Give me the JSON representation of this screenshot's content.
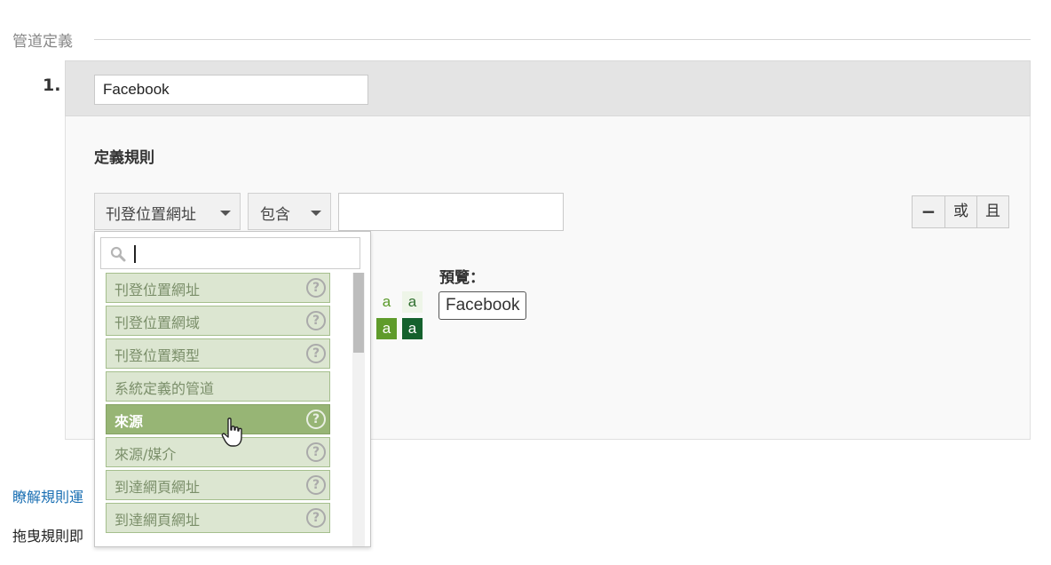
{
  "section": {
    "title": "管道定義"
  },
  "channel": {
    "number": "1.",
    "name_value": "Facebook"
  },
  "rules": {
    "title": "定義規則",
    "dimension_selected": "刊登位置網址",
    "operator_selected": "包含",
    "value": "",
    "buttons": {
      "remove": "−",
      "or": "或",
      "and": "且"
    }
  },
  "dropdown": {
    "search_value": "",
    "items": [
      {
        "label": "刊登位置網址",
        "help": "?"
      },
      {
        "label": "刊登位置網域",
        "help": "?"
      },
      {
        "label": "刊登位置類型",
        "help": "?"
      },
      {
        "label": "系統定義的管道",
        "help": ""
      },
      {
        "label": "來源",
        "help": "?"
      },
      {
        "label": "來源/媒介",
        "help": "?"
      },
      {
        "label": "到達網頁網址",
        "help": "?"
      },
      {
        "label": "到達網頁網址",
        "help": "?"
      }
    ],
    "highlighted_index": 4
  },
  "colors": {
    "chips": [
      {
        "text": "a",
        "bg": "#f9f9f9",
        "fg": "#5a9a2a"
      },
      {
        "text": "a",
        "bg": "#eef5e8",
        "fg": "#2f6f2f"
      },
      {
        "text": "a",
        "bg": "#5f9b2b",
        "fg": "#ffffff"
      },
      {
        "text": "a",
        "bg": "#14612d",
        "fg": "#ffffff"
      }
    ],
    "item_bg": "#dce6d1",
    "item_active_bg": "#97b575",
    "link": "#1a6fb3"
  },
  "preview": {
    "label": "預覽：",
    "badge": "Facebook"
  },
  "footer": {
    "learn_link": "瞭解規則運",
    "drag_hint": "拖曳規則即"
  },
  "icons": {
    "search": "search-icon",
    "help": "help-icon",
    "caret": "chevron-down-icon",
    "cursor": "hand-pointer-icon"
  }
}
